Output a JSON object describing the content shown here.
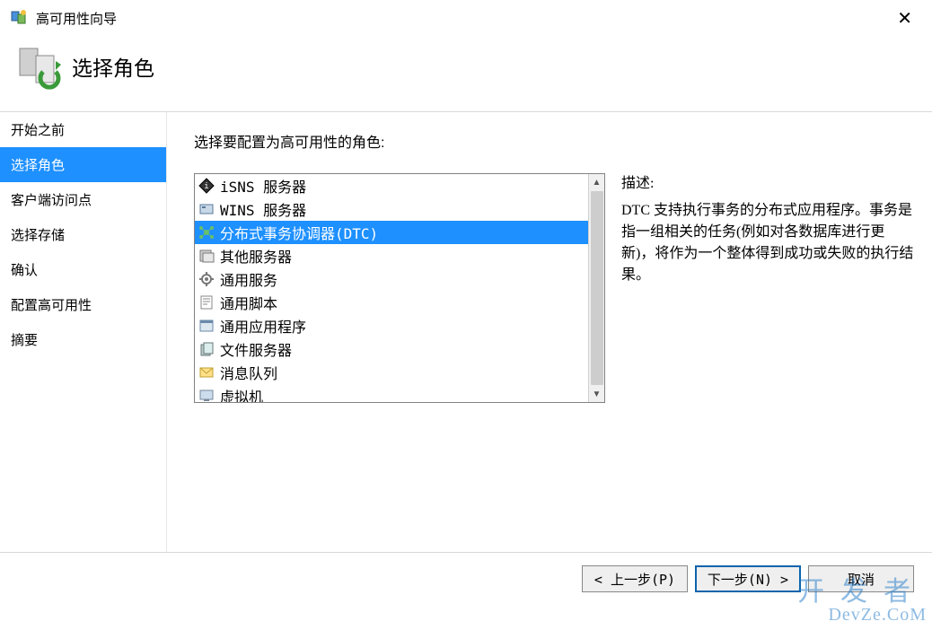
{
  "window": {
    "title": "高可用性向导",
    "close": "✕"
  },
  "header": {
    "title": "选择角色"
  },
  "sidebar": {
    "items": [
      {
        "label": "开始之前",
        "selected": false
      },
      {
        "label": "选择角色",
        "selected": true
      },
      {
        "label": "客户端访问点",
        "selected": false
      },
      {
        "label": "选择存储",
        "selected": false
      },
      {
        "label": "确认",
        "selected": false
      },
      {
        "label": "配置高可用性",
        "selected": false
      },
      {
        "label": "摘要",
        "selected": false
      }
    ]
  },
  "main": {
    "instruction": "选择要配置为高可用性的角色:",
    "list_items": [
      {
        "label": "iSNS 服务器",
        "icon": "isns",
        "selected": false
      },
      {
        "label": "WINS 服务器",
        "icon": "wins",
        "selected": false
      },
      {
        "label": "分布式事务协调器(DTC)",
        "icon": "dtc",
        "selected": true
      },
      {
        "label": "其他服务器",
        "icon": "other",
        "selected": false
      },
      {
        "label": "通用服务",
        "icon": "gear",
        "selected": false
      },
      {
        "label": "通用脚本",
        "icon": "script",
        "selected": false
      },
      {
        "label": "通用应用程序",
        "icon": "app",
        "selected": false
      },
      {
        "label": "文件服务器",
        "icon": "file",
        "selected": false
      },
      {
        "label": "消息队列",
        "icon": "queue",
        "selected": false
      },
      {
        "label": "虚拟机",
        "icon": "vm",
        "selected": false
      }
    ],
    "scroll": {
      "up": "▲",
      "down": "▼"
    },
    "description": {
      "title": "描述:",
      "body": "DTC 支持执行事务的分布式应用程序。事务是指一组相关的任务(例如对各数据库进行更新)，将作为一个整体得到成功或失败的执行结果。"
    }
  },
  "footer": {
    "prev": "< 上一步(P)",
    "next": "下一步(N) >",
    "cancel": "取消"
  },
  "watermark": {
    "line1": "开发者",
    "line2": "DevZe.CoM"
  }
}
